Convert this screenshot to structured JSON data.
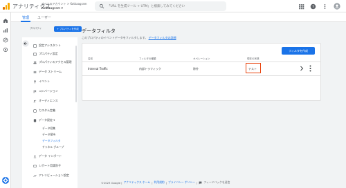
{
  "app": {
    "title": "アナリティクス",
    "account_path": "すべてのアカウント > Kotkaagram",
    "account_name": "Kotkaagram ▾"
  },
  "search": {
    "placeholder": "「URL を生成ツール + UTM」と検索してみてください"
  },
  "admin_tabs": [
    {
      "label": "管理"
    },
    {
      "label": "ユーザー"
    }
  ],
  "property": {
    "label": "プロパティ",
    "create_button": "+ プロパティを作成"
  },
  "sidebar": {
    "items": [
      {
        "label": "設定アシスタント"
      },
      {
        "label": "プロパティ設定"
      },
      {
        "label": "プロパティのアクセス管理"
      },
      {
        "label": "データ ストリーム"
      },
      {
        "label": "イベント"
      },
      {
        "label": "コンバージョン"
      },
      {
        "label": "オーディエンス"
      },
      {
        "label": "カスタム定義"
      },
      {
        "label": "データ設定 ▾"
      },
      {
        "label": "データ インポート"
      },
      {
        "label": "レポート用識別子"
      },
      {
        "label": "アトリビューション設定"
      }
    ],
    "sub_items": [
      {
        "label": "データ収集"
      },
      {
        "label": "データ保持"
      },
      {
        "label": "データフィルタ"
      },
      {
        "label": "チャネル グループ"
      }
    ]
  },
  "main": {
    "title": "データフィルタ",
    "description": "このプロパティのイベントデータをフィルタします。",
    "learn_more": "データフィルタの詳細",
    "create_button": "フィルタを作成",
    "columns": [
      "名前",
      "フィルタの種類",
      "オペレーション",
      "現在の状態"
    ],
    "rows": [
      {
        "name": "Internal Traffic",
        "type": "内部トラフィック",
        "operation": "除外",
        "state": "テスト"
      }
    ]
  },
  "footer": {
    "copyright": "©2023 Google |",
    "links": [
      "アナリティクス ホーム",
      "利用規約",
      "プライバシー ポリシー"
    ],
    "feedback": "フィードバックを送信"
  },
  "colors": {
    "accent": "#1a73e8",
    "highlight": "#e8410b",
    "logo": [
      "#f9ab00",
      "#e37400"
    ]
  }
}
